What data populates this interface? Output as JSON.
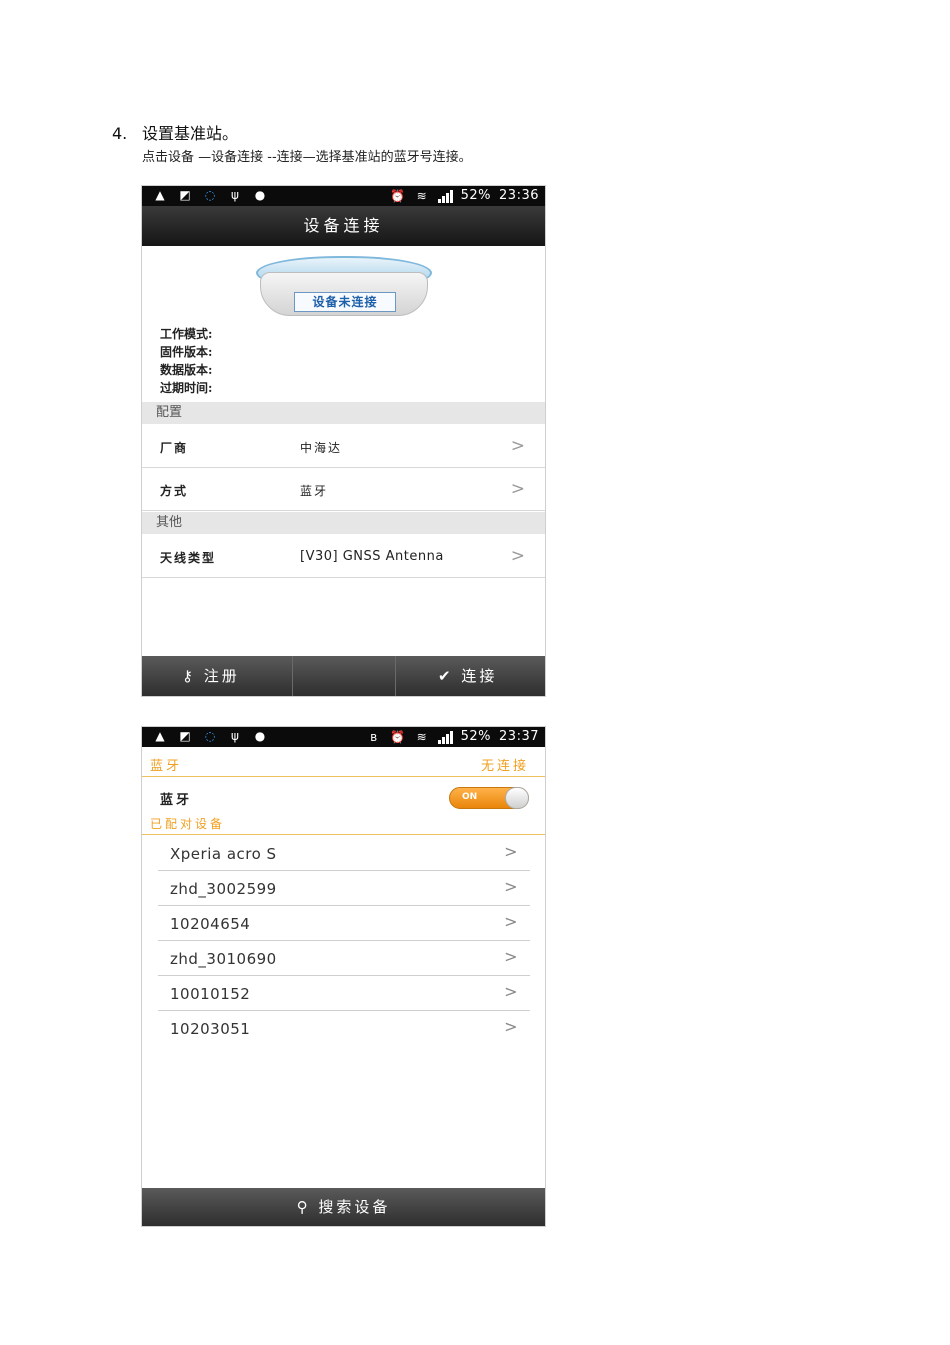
{
  "step": {
    "number": "4.",
    "title": "设置基准站。",
    "desc": "点击设备 —设备连接 --连接—选择基准站的蓝牙号连接。"
  },
  "screen1": {
    "status": {
      "battery": "52%",
      "time": "23:36"
    },
    "title": "设备连接",
    "device_label": "设备未连接",
    "info": [
      "工作模式:",
      "固件版本:",
      "数据版本:",
      "过期时间:"
    ],
    "config_header": "配置",
    "rows": [
      {
        "label": "厂商",
        "value": "中海达"
      },
      {
        "label": "方式",
        "value": "蓝牙"
      }
    ],
    "other_header": "其他",
    "antenna": {
      "label": "天线类型",
      "value": "[V30] GNSS Antenna"
    },
    "bottom": {
      "register": "注册",
      "connect": "连接"
    }
  },
  "screen2": {
    "status": {
      "battery": "52%",
      "time": "23:37"
    },
    "header": {
      "left": "蓝牙",
      "right": "无连接"
    },
    "bt_label": "蓝牙",
    "toggle": "ON",
    "paired_header": "已配对设备",
    "devices": [
      "Xperia acro S",
      "zhd_3002599",
      "10204654",
      "zhd_3010690",
      "10010152",
      "10203051"
    ],
    "search": "搜索设备"
  }
}
